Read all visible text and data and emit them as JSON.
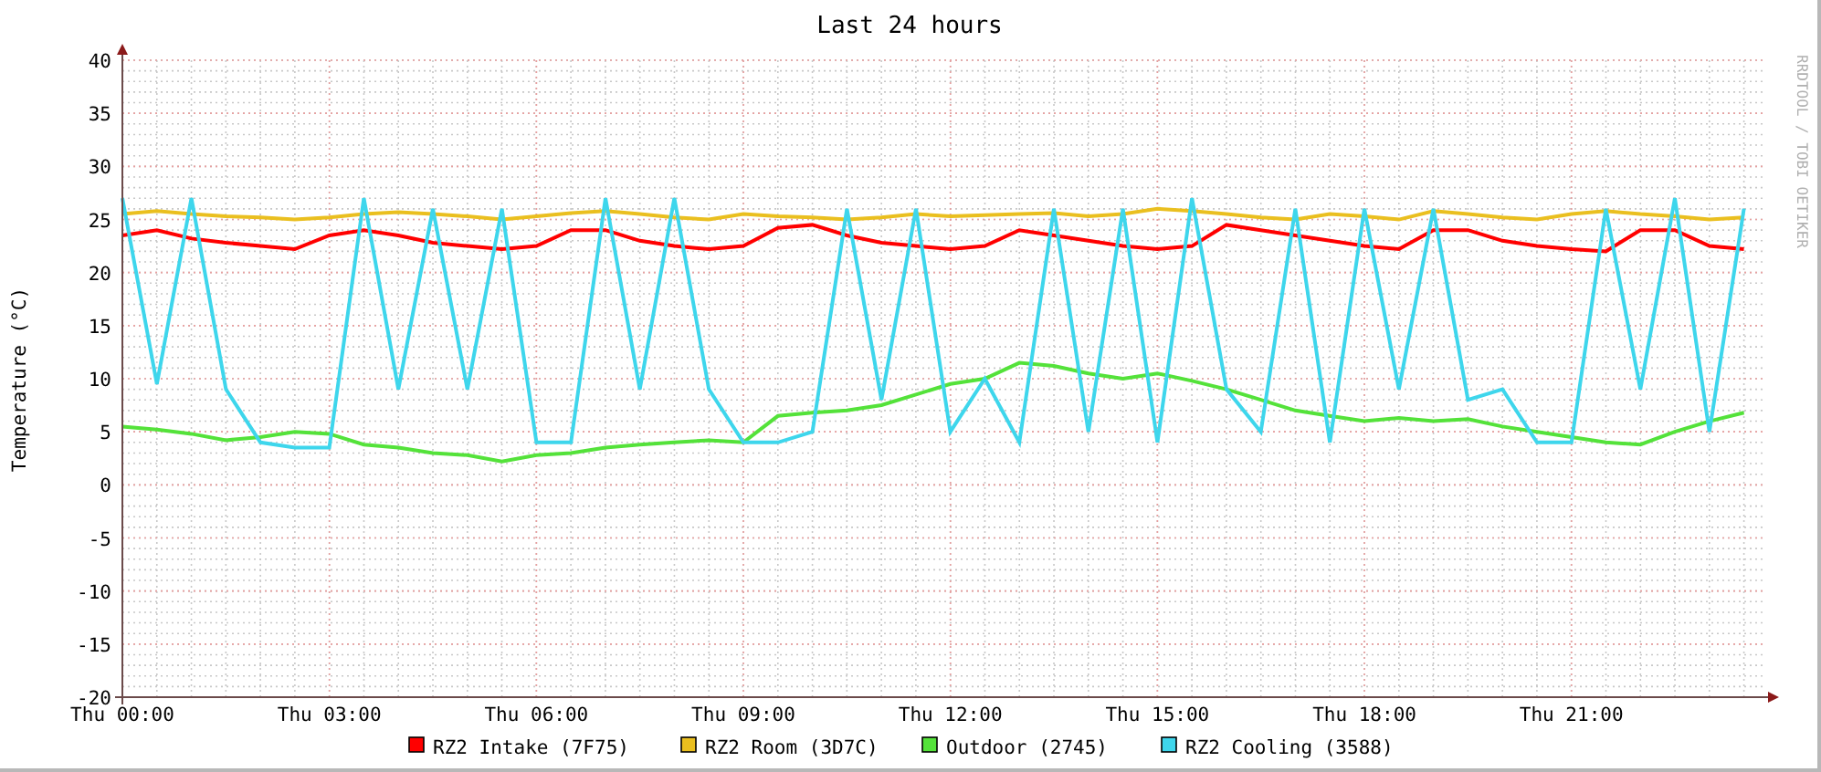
{
  "chart": {
    "chart_data": {
      "type": "line",
      "title": "Last 24 hours",
      "ylabel": "Temperature (°C)",
      "categories": [
        "Thu 00:00",
        null,
        null,
        null,
        null,
        null,
        "Thu 03:00",
        null,
        null,
        null,
        null,
        null,
        "Thu 06:00",
        null,
        null,
        null,
        null,
        null,
        "Thu 09:00",
        null,
        null,
        null,
        null,
        null,
        "Thu 12:00",
        null,
        null,
        null,
        null,
        null,
        "Thu 15:00",
        null,
        null,
        null,
        null,
        null,
        "Thu 18:00",
        null,
        null,
        null,
        null,
        null,
        "Thu 21:00",
        null,
        null,
        null,
        null,
        null
      ],
      "ylim": [
        -20,
        40
      ],
      "grid": true,
      "legend": true,
      "yticks": [
        -20,
        -15,
        -10,
        -5,
        0,
        5,
        10,
        15,
        20,
        25,
        30,
        35,
        40
      ],
      "series": [
        {
          "name": "RZ2 Intake (7F75)",
          "color": "#ff0000",
          "values": [
            23.5,
            24,
            23.2,
            22.8,
            22.5,
            22.2,
            23.5,
            24,
            23.5,
            22.8,
            22.5,
            22.2,
            22.5,
            24,
            24,
            23,
            22.5,
            22.2,
            22.5,
            24.2,
            24.5,
            23.5,
            22.8,
            22.5,
            22.2,
            22.5,
            24,
            23.5,
            23,
            22.5,
            22.2,
            22.5,
            24.5,
            24,
            23.5,
            23,
            22.5,
            22.2,
            24,
            24,
            23,
            22.5,
            22.2,
            22,
            24,
            24,
            22.5,
            22.2
          ]
        },
        {
          "name": "RZ2 Room (3D7C)",
          "color": "#eabf1f",
          "values": [
            25.5,
            25.8,
            25.5,
            25.3,
            25.2,
            25.0,
            25.2,
            25.5,
            25.7,
            25.5,
            25.3,
            25.0,
            25.3,
            25.6,
            25.8,
            25.5,
            25.2,
            25.0,
            25.5,
            25.3,
            25.2,
            25.0,
            25.2,
            25.5,
            25.3,
            25.4,
            25.5,
            25.6,
            25.3,
            25.5,
            26.0,
            25.8,
            25.5,
            25.2,
            25.0,
            25.5,
            25.3,
            25.0,
            25.8,
            25.5,
            25.2,
            25.0,
            25.5,
            25.8,
            25.5,
            25.3,
            25.0,
            25.2
          ]
        },
        {
          "name": "Outdoor (2745)",
          "color": "#54e23a",
          "values": [
            5.5,
            5.2,
            4.8,
            4.2,
            4.5,
            5.0,
            4.8,
            3.8,
            3.5,
            3.0,
            2.8,
            2.2,
            2.8,
            3.0,
            3.5,
            3.8,
            4.0,
            4.2,
            4.0,
            6.5,
            6.8,
            7.0,
            7.5,
            8.5,
            9.5,
            10.0,
            11.5,
            11.2,
            10.5,
            10.0,
            10.5,
            9.8,
            9.0,
            8.0,
            7.0,
            6.5,
            6.0,
            6.3,
            6.0,
            6.2,
            5.5,
            5.0,
            4.5,
            4.0,
            3.8,
            5.0,
            6.0,
            6.8
          ]
        },
        {
          "name": "RZ2 Cooling (3588)",
          "color": "#3ed6ec",
          "values": [
            27,
            9.5,
            27,
            9,
            4,
            3.5,
            3.5,
            27,
            9,
            26,
            9,
            26,
            4,
            4,
            27,
            9,
            27,
            9,
            4,
            4,
            5,
            26,
            8,
            26,
            5,
            10,
            4,
            26,
            5,
            26,
            4,
            27,
            9,
            5,
            26,
            4,
            26,
            9,
            26,
            8,
            9,
            4,
            4,
            26,
            9,
            27,
            5,
            26
          ]
        }
      ]
    }
  },
  "side_text": "RRDTOOL / TOBI OETIKER"
}
